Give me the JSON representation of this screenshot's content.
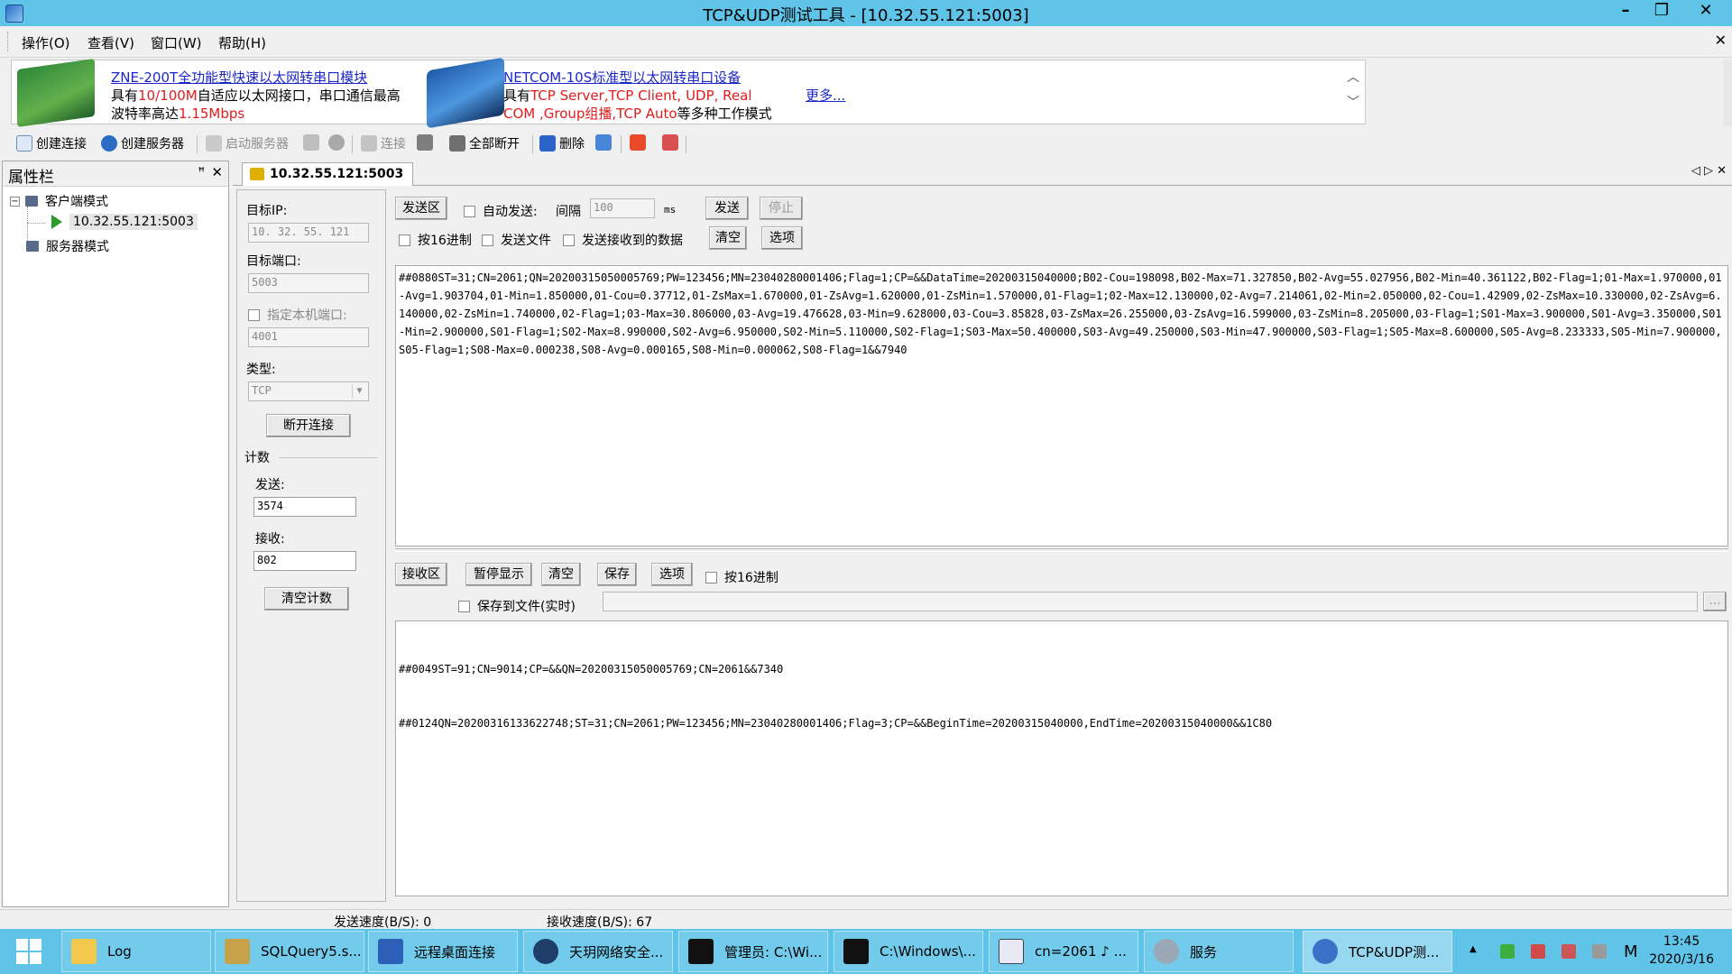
{
  "window": {
    "title": "TCP&UDP测试工具 - [10.32.55.121:5003]",
    "minimize": "–",
    "restore": "❐",
    "close": "✕"
  },
  "menu": {
    "items": [
      "操作(O)",
      "查看(V)",
      "窗口(W)",
      "帮助(H)"
    ],
    "close_child": "✕"
  },
  "banner": {
    "product1_title": "ZNE-200T全功能型快速以太网转串口模块",
    "product1_line2_a": "具有",
    "product1_line2_b": "10/100M",
    "product1_line2_c": "自适应以太网接口，串口通信最高",
    "product1_line3_a": "波特率高达",
    "product1_line3_b": "1.15Mbps",
    "product2_title": "NETCOM-10S标准型以太网转串口设备",
    "product2_line2_a": "具有",
    "product2_line2_b": "TCP Server,TCP Client, UDP, Real",
    "product2_line3_a": "COM ,Group组播,TCP Auto",
    "product2_line3_b": "等多种工作模式",
    "more": "更多...",
    "scroll_up": "︿",
    "scroll_down": "﹀"
  },
  "toolbar": {
    "create_connection": "创建连接",
    "create_server": "创建服务器",
    "start_server": "启动服务器",
    "connect": "连接",
    "disconnect_all": "全部断开",
    "delete": "删除"
  },
  "property_panel": {
    "title": "属性栏",
    "pin": "ꟸ",
    "close": "✕",
    "client_mode": "客户端模式",
    "connection": "10.32.55.121:5003",
    "server_mode": "服务器模式"
  },
  "doc_tab": {
    "label": "10.32.55.121:5003",
    "nav": "◁ ▷ ✕"
  },
  "config": {
    "target_ip_label": "目标IP:",
    "target_ip_value": "10. 32. 55. 121",
    "target_port_label": "目标端口:",
    "target_port_value": "5003",
    "local_port_label": "指定本机端口:",
    "local_port_value": "4001",
    "type_label": "类型:",
    "type_value": "TCP",
    "disconnect_button": "断开连接",
    "count_label": "计数",
    "send_label": "发送:",
    "send_count": "3574",
    "recv_label": "接收:",
    "recv_count": "802",
    "clear_count_button": "清空计数"
  },
  "send_area": {
    "section_button": "发送区",
    "auto_send": "自动发送:",
    "interval_label": "间隔",
    "interval_value": "100",
    "interval_unit": "ms",
    "send_button": "发送",
    "stop_button": "停止",
    "hex": "按16进制",
    "send_file": "发送文件",
    "send_received": "发送接收到的数据",
    "clear_button": "清空",
    "options_button": "选项",
    "content": "##0880ST=31;CN=2061;QN=20200315050005769;PW=123456;MN=23040280001406;Flag=1;CP=&&DataTime=20200315040000;B02-Cou=198098,B02-Max=71.327850,B02-Avg=55.027956,B02-Min=40.361122,B02-Flag=1;01-Max=1.970000,01-Avg=1.903704,01-Min=1.850000,01-Cou=0.37712,01-ZsMax=1.670000,01-ZsAvg=1.620000,01-ZsMin=1.570000,01-Flag=1;02-Max=12.130000,02-Avg=7.214061,02-Min=2.050000,02-Cou=1.42909,02-ZsMax=10.330000,02-ZsAvg=6.140000,02-ZsMin=1.740000,02-Flag=1;03-Max=30.806000,03-Avg=19.476628,03-Min=9.628000,03-Cou=3.85828,03-ZsMax=26.255000,03-ZsAvg=16.599000,03-ZsMin=8.205000,03-Flag=1;S01-Max=3.900000,S01-Avg=3.350000,S01-Min=2.900000,S01-Flag=1;S02-Max=8.990000,S02-Avg=6.950000,S02-Min=5.110000,S02-Flag=1;S03-Max=50.400000,S03-Avg=49.250000,S03-Min=47.900000,S03-Flag=1;S05-Max=8.600000,S05-Avg=8.233333,S05-Min=7.900000,S05-Flag=1;S08-Max=0.000238,S08-Avg=0.000165,S08-Min=0.000062,S08-Flag=1&&7940"
  },
  "recv_area": {
    "section_button": "接收区",
    "pause_button": "暂停显示",
    "clear_button": "清空",
    "save_button": "保存",
    "options_button": "选项",
    "hex": "按16进制",
    "save_to_file": "保存到文件(实时)",
    "browse": "...",
    "line1": "##0049ST=91;CN=9014;CP=&&QN=20200315050005769;CN=2061&&7340",
    "line2": "##0124QN=20200316133622748;ST=31;CN=2061;PW=123456;MN=23040280001406;Flag=3;CP=&&BeginTime=20200315040000,EndTime=20200315040000&&1C80"
  },
  "status": {
    "send_speed": "发送速度(B/S): 0",
    "recv_speed": "接收速度(B/S): 67"
  },
  "taskbar": {
    "items": [
      "Log",
      "SQLQuery5.s...",
      "远程桌面连接",
      "天玥网络安全...",
      "管理员: C:\\Wi...",
      "C:\\Windows\\...",
      "cn=2061 ♪ ...",
      "服务",
      "TCP&UDP测..."
    ],
    "tray_letter": "M",
    "time": "13:45",
    "date": "2020/3/16"
  },
  "colors": {
    "titlebar": "#5fc4e8",
    "link": "#1b28c9",
    "highlight": "#e31b1b"
  }
}
